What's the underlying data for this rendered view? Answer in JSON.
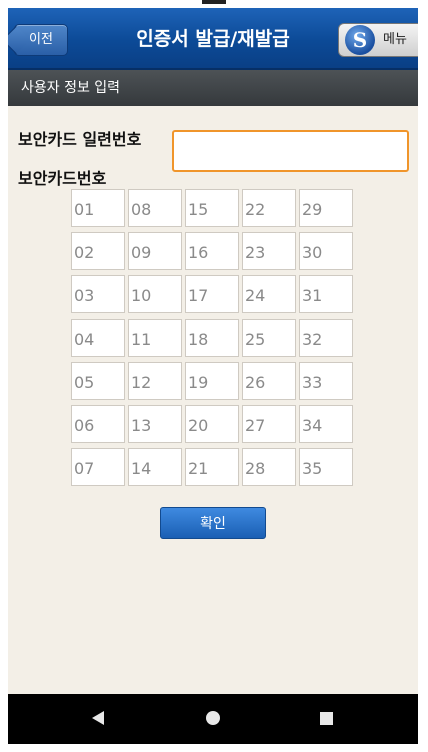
{
  "header": {
    "back_label": "이전",
    "title": "인증서 발급/재발급",
    "menu_label": "메뉴",
    "logo_letter": "S"
  },
  "subheader": {
    "title": "사용자 정보 입력"
  },
  "form": {
    "serial_label": "보안카드 일련번호",
    "serial_value": "",
    "card_number_label": "보안카드번호"
  },
  "code_grid": {
    "columns": [
      [
        "01",
        "02",
        "03",
        "04",
        "05",
        "06",
        "07"
      ],
      [
        "08",
        "09",
        "10",
        "11",
        "12",
        "13",
        "14"
      ],
      [
        "15",
        "16",
        "17",
        "18",
        "19",
        "20",
        "21"
      ],
      [
        "22",
        "23",
        "24",
        "25",
        "26",
        "27",
        "28"
      ],
      [
        "29",
        "30",
        "31",
        "32",
        "33",
        "34",
        "35"
      ]
    ]
  },
  "confirm_label": "확인",
  "colors": {
    "header_blue": "#0c4a97",
    "subheader_dark": "#3b3f42",
    "input_focus_orange": "#f0952b",
    "confirm_blue": "#2a6fc6"
  },
  "system_nav": {
    "icons": [
      "back-triangle-icon",
      "home-circle-icon",
      "recent-square-icon"
    ]
  }
}
